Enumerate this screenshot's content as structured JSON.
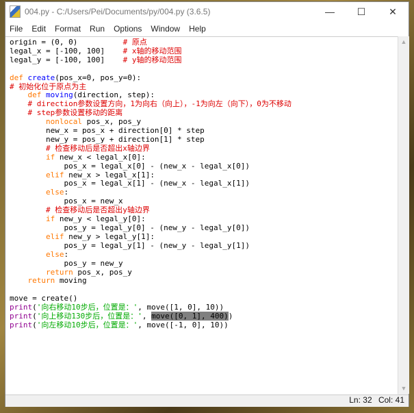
{
  "window": {
    "title": "004.py - C:/Users/Pei/Documents/py/004.py (3.6.5)",
    "minimize": "—",
    "maximize": "☐",
    "close": "✕"
  },
  "menu": [
    "File",
    "Edit",
    "Format",
    "Run",
    "Options",
    "Window",
    "Help"
  ],
  "colors": {
    "keyword": "#ff7700",
    "definition": "#0000ff",
    "comment": "#dd0000",
    "builtin": "#900090",
    "string": "#00aa00",
    "selection": "#808080"
  },
  "code": [
    [
      [
        "n",
        "origin = (0, 0)          "
      ],
      [
        "c",
        "# 原点"
      ]
    ],
    [
      [
        "n",
        "legal_x = [-100, 100]    "
      ],
      [
        "c",
        "# x轴的移动范围"
      ]
    ],
    [
      [
        "n",
        "legal_y = [-100, 100]    "
      ],
      [
        "c",
        "# y轴的移动范围"
      ]
    ],
    [
      [
        "n",
        ""
      ]
    ],
    [
      [
        "k",
        "def"
      ],
      [
        "n",
        " "
      ],
      [
        "d",
        "create"
      ],
      [
        "n",
        "(pos_x=0, pos_y=0):"
      ]
    ],
    [
      [
        "c",
        "# 初始化位于原点为主"
      ]
    ],
    [
      [
        "n",
        "    "
      ],
      [
        "k",
        "def"
      ],
      [
        "n",
        " "
      ],
      [
        "d",
        "moving"
      ],
      [
        "n",
        "(direction, step):"
      ]
    ],
    [
      [
        "n",
        "    "
      ],
      [
        "c",
        "# direction参数设置方向，1为向右（向上），-1为向左（向下），0为不移动"
      ]
    ],
    [
      [
        "n",
        "    "
      ],
      [
        "c",
        "# step参数设置移动的距离"
      ]
    ],
    [
      [
        "n",
        "        "
      ],
      [
        "k",
        "nonlocal"
      ],
      [
        "n",
        " pos_x, pos_y"
      ]
    ],
    [
      [
        "n",
        "        new_x = pos_x + direction[0] * step"
      ]
    ],
    [
      [
        "n",
        "        new_y = pos_y + direction[1] * step"
      ]
    ],
    [
      [
        "n",
        "        "
      ],
      [
        "c",
        "# 检查移动后是否超出x轴边界"
      ]
    ],
    [
      [
        "n",
        "        "
      ],
      [
        "k",
        "if"
      ],
      [
        "n",
        " new_x < legal_x[0]:"
      ]
    ],
    [
      [
        "n",
        "            pos_x = legal_x[0] - (new_x - legal_x[0])"
      ]
    ],
    [
      [
        "n",
        "        "
      ],
      [
        "k",
        "elif"
      ],
      [
        "n",
        " new_x > legal_x[1]:"
      ]
    ],
    [
      [
        "n",
        "            pos_x = legal_x[1] - (new_x - legal_x[1])"
      ]
    ],
    [
      [
        "n",
        "        "
      ],
      [
        "k",
        "else"
      ],
      [
        "n",
        ":"
      ]
    ],
    [
      [
        "n",
        "            pos_x = new_x"
      ]
    ],
    [
      [
        "n",
        "        "
      ],
      [
        "c",
        "# 检查移动后是否超出y轴边界"
      ]
    ],
    [
      [
        "n",
        "        "
      ],
      [
        "k",
        "if"
      ],
      [
        "n",
        " new_y < legal_y[0]:"
      ]
    ],
    [
      [
        "n",
        "            pos_y = legal_y[0] - (new_y - legal_y[0])"
      ]
    ],
    [
      [
        "n",
        "        "
      ],
      [
        "k",
        "elif"
      ],
      [
        "n",
        " new_y > legal_y[1]:"
      ]
    ],
    [
      [
        "n",
        "            pos_y = legal_y[1] - (new_y - legal_y[1])"
      ]
    ],
    [
      [
        "n",
        "        "
      ],
      [
        "k",
        "else"
      ],
      [
        "n",
        ":"
      ]
    ],
    [
      [
        "n",
        "            pos_y = new_y"
      ]
    ],
    [
      [
        "n",
        "        "
      ],
      [
        "k",
        "return"
      ],
      [
        "n",
        " pos_x, pos_y"
      ]
    ],
    [
      [
        "n",
        "    "
      ],
      [
        "k",
        "return"
      ],
      [
        "n",
        " moving"
      ]
    ],
    [
      [
        "n",
        ""
      ]
    ],
    [
      [
        "n",
        "move = create()"
      ]
    ],
    [
      [
        "b",
        "print"
      ],
      [
        "n",
        "("
      ],
      [
        "s",
        "'向右移动10步后，位置是：'"
      ],
      [
        "n",
        ", move([1, 0], 10))"
      ]
    ],
    [
      [
        "b",
        "print"
      ],
      [
        "n",
        "("
      ],
      [
        "s",
        "'向上移动130步后，位置是：'"
      ],
      [
        "n",
        ", "
      ],
      [
        "h",
        "move([0, 1], 400)"
      ],
      [
        "n",
        ")"
      ]
    ],
    [
      [
        "b",
        "print"
      ],
      [
        "n",
        "("
      ],
      [
        "s",
        "'向左移动10步后，位置是：'"
      ],
      [
        "n",
        ", move([-1, 0], 10))"
      ]
    ]
  ],
  "status": {
    "line": "Ln: 32",
    "col": "Col: 41"
  }
}
